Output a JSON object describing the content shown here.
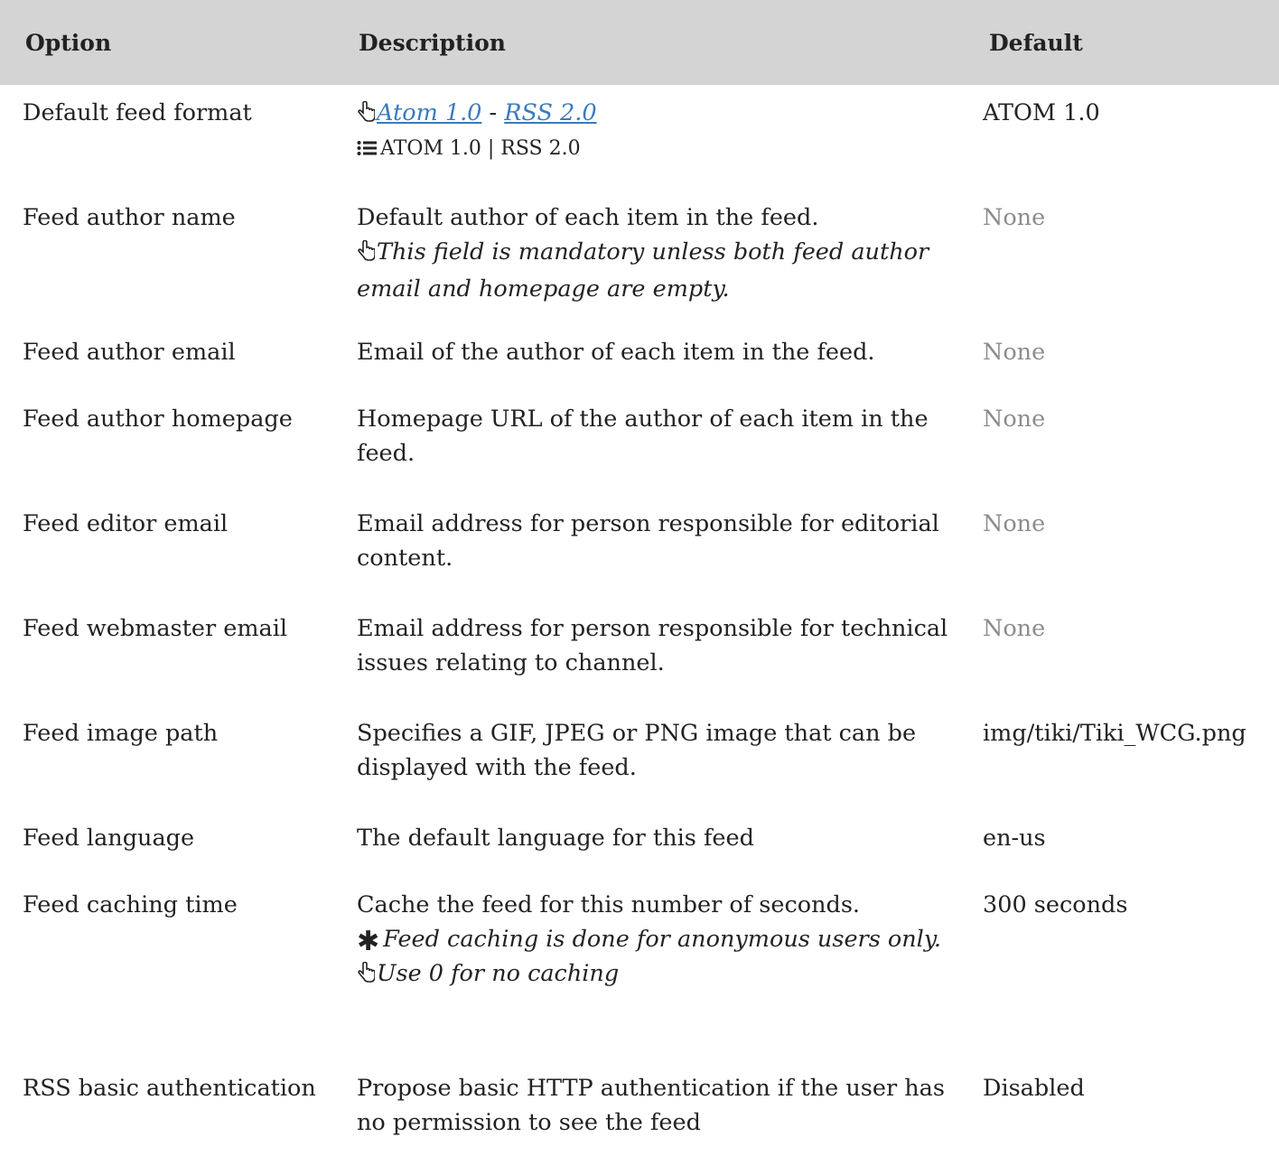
{
  "headers": {
    "option": "Option",
    "description": "Description",
    "default": "Default"
  },
  "rows": [
    {
      "option": "Default feed format",
      "link1": "Atom 1.0",
      "sep": " - ",
      "link2": "RSS 2.0",
      "choices": "ATOM 1.0 | RSS 2.0",
      "default": "ATOM 1.0"
    },
    {
      "option": "Feed author name",
      "desc": "Default author of each item in the feed.",
      "note": "This field is mandatory unless both feed author email and homepage are empty.",
      "default": "None"
    },
    {
      "option": "Feed author email",
      "desc": "Email of the author of each item in the feed.",
      "default": "None"
    },
    {
      "option": "Feed author homepage",
      "desc": "Homepage URL of the author of each item in the feed.",
      "default": "None"
    },
    {
      "option": "Feed editor email",
      "desc": "Email address for person responsible for editorial content.",
      "default": "None"
    },
    {
      "option": "Feed webmaster email",
      "desc": "Email address for person responsible for technical issues relating to channel.",
      "default": "None"
    },
    {
      "option": "Feed image path",
      "desc": "Specifies a GIF, JPEG or PNG image that can be displayed with the feed.",
      "default": "img/tiki/Tiki_WCG.png"
    },
    {
      "option": "Feed language",
      "desc": "The default language for this feed",
      "default": "en-us"
    },
    {
      "option": "Feed caching time",
      "desc": "Cache the feed for this number of seconds.",
      "warning": "Feed caching is done for anonymous users only.",
      "tip": "Use 0 for no caching",
      "default": "300 seconds"
    },
    {
      "option": "RSS basic authentication",
      "desc": "Propose basic HTTP authentication if the user has no permission to see the feed",
      "default": "Disabled"
    }
  ],
  "colors": {
    "header_bg": "#d4d4d4",
    "link": "#3a7abf",
    "muted": "#8c8c8c",
    "text": "#222222"
  }
}
